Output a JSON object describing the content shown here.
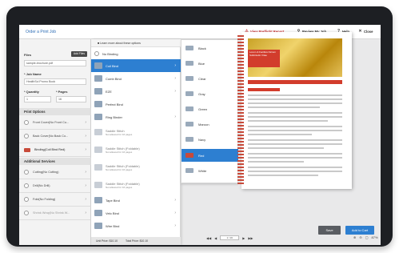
{
  "app": {
    "title": "Order a Print Job"
  },
  "toolbar": {
    "preflight": "View Preflight Report",
    "review": "Review My Job",
    "help": "Help",
    "close": "Close"
  },
  "sidebar": {
    "files_label": "Files",
    "add_files": "Add Files",
    "file_name": "sample-brochure.pdf",
    "job_name_label": "* Job Name",
    "job_name_value": "HealthSci Promo Book",
    "quantity_label": "* Quantity",
    "quantity_value": "1",
    "pages_label": "* Pages",
    "pages_value": "16",
    "print_options_title": "Print Options",
    "print_options": [
      {
        "label": "Front Cover(No Front Co..."
      },
      {
        "label": "Back Cover(No Back Co..."
      },
      {
        "label": "Binding(Coil Bind Red)"
      }
    ],
    "additional_services_title": "Additional Services",
    "additional_services": [
      {
        "label": "Cutting(No Cutting)"
      },
      {
        "label": "Drill(No Drill)"
      },
      {
        "label": "Fold(No Folding)"
      },
      {
        "label": "Shrink Wrap(No Shrink W..."
      }
    ]
  },
  "binding_menu": {
    "header": "Learn more about these options",
    "items": [
      {
        "label": "No Binding",
        "sub": ""
      },
      {
        "label": "Coil Bind",
        "sub": ""
      },
      {
        "label": "Comb Bind",
        "sub": ""
      },
      {
        "label": "EZE",
        "sub": ""
      },
      {
        "label": "Perfect Bind",
        "sub": ""
      },
      {
        "label": "Ring Binder",
        "sub": ""
      },
      {
        "label": "Saddle Stitch",
        "sub": "Not allowed for 16 pages"
      },
      {
        "label": "Saddle Stitch (Foldable)",
        "sub": "Not allowed for 16 pages"
      },
      {
        "label": "Saddle Stitch (Foldable)",
        "sub": "Not allowed for 16 pages"
      },
      {
        "label": "Saddle Stitch (Foldable)",
        "sub": "Not allowed for 16 pages"
      },
      {
        "label": "Tape Bind",
        "sub": ""
      },
      {
        "label": "Velo Bind",
        "sub": ""
      },
      {
        "label": "Wire Bind",
        "sub": ""
      }
    ],
    "unit_price": "Unit Price: $10.10",
    "total_price": "Total Price: $10.10"
  },
  "color_menu": {
    "items": [
      {
        "label": "Black"
      },
      {
        "label": "Blue"
      },
      {
        "label": "Clear"
      },
      {
        "label": "Gray"
      },
      {
        "label": "Green"
      },
      {
        "label": "Maroon"
      },
      {
        "label": "Navy"
      },
      {
        "label": "Red"
      },
      {
        "label": "White"
      }
    ]
  },
  "preview": {
    "doc_title": "Lorem & Facilisis Dictum Sollicitudin Vitae",
    "page_indicator": "1 / 16",
    "zoom": "87%"
  },
  "actions": {
    "save": "Save",
    "add_to_cart": "Add to Cart"
  },
  "colors": {
    "accent": "#2d7fd1",
    "brand_red": "#d23c2c"
  }
}
